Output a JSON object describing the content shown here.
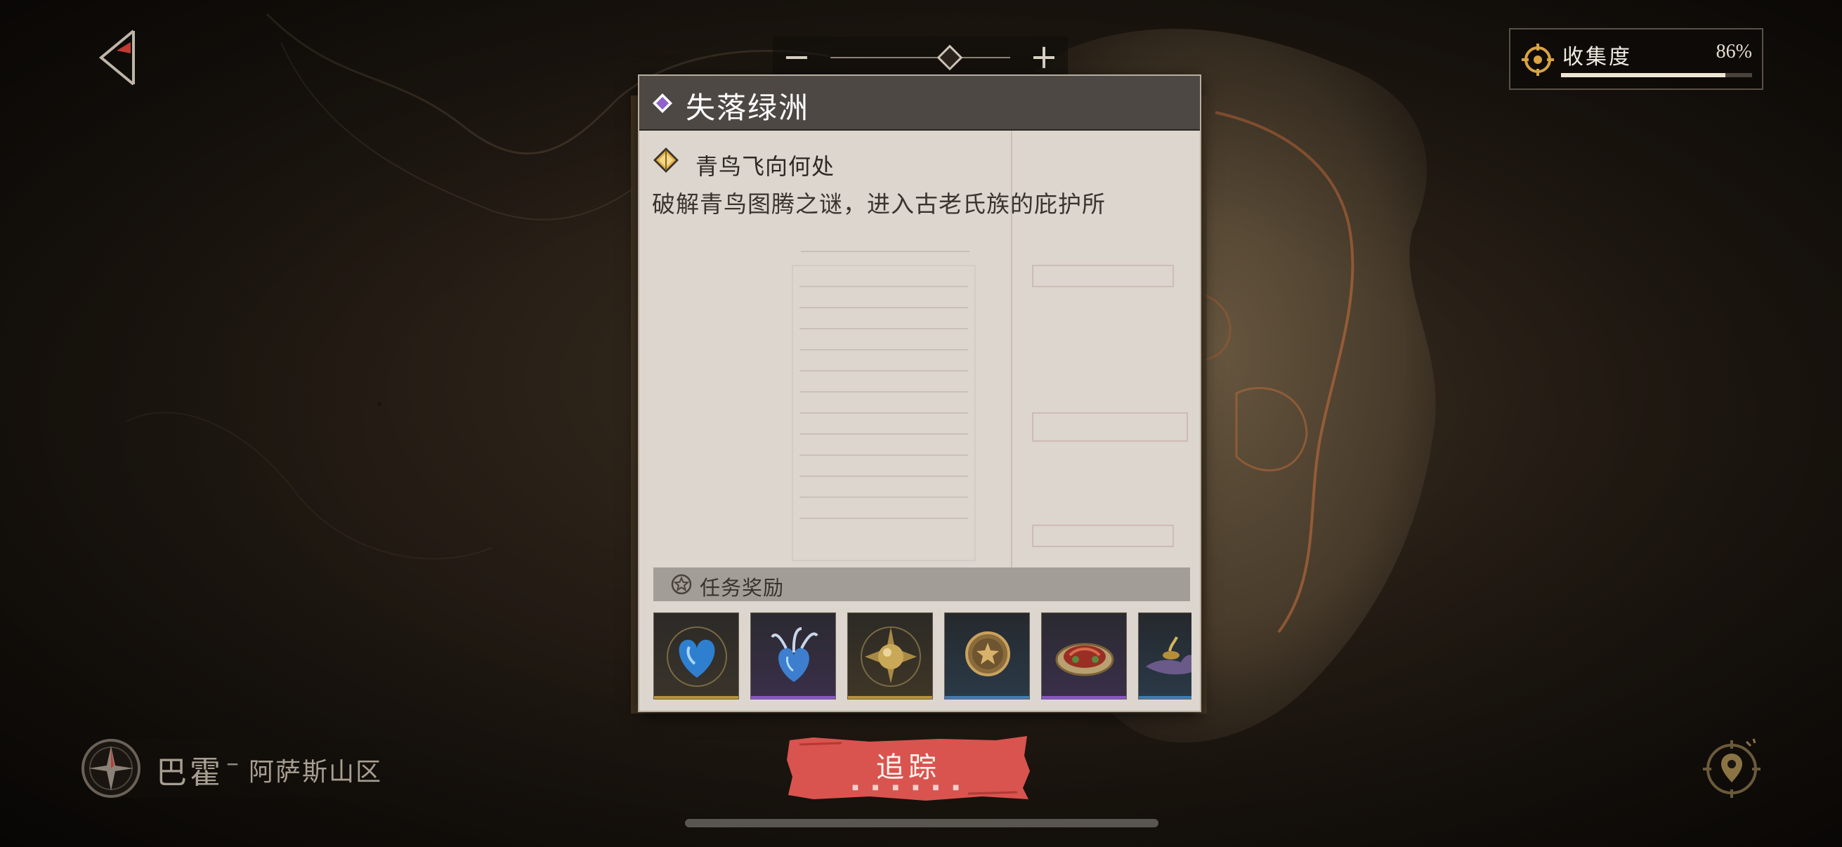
{
  "zoom": {
    "minus_label": "−",
    "plus_label": "+",
    "level": 0.5
  },
  "collection": {
    "label": "收集度",
    "value": "86%",
    "progress": 0.86
  },
  "quest": {
    "title": "失落绿洲",
    "subquest": "青鸟飞向何处",
    "description": "破解青鸟图腾之谜，进入古老氏族的庇护所",
    "rewards_label": "任务奖励",
    "rewards": [
      {
        "icon": "blue-heart-gem-icon",
        "rarity_color": "#b7943a"
      },
      {
        "icon": "tentacle-heart-gem-icon",
        "rarity_color": "#8a55c7"
      },
      {
        "icon": "golden-spiked-orb-icon",
        "rarity_color": "#b7943a"
      },
      {
        "icon": "bronze-star-coin-icon",
        "rarity_color": "#3d7eb3"
      },
      {
        "icon": "meat-platter-icon",
        "rarity_color": "#8a55c7"
      },
      {
        "icon": "oil-lamp-icon",
        "rarity_color": "#3d7eb3"
      }
    ]
  },
  "track_button": {
    "label": "追踪",
    "accent": "#d9534f"
  },
  "location": {
    "region": "巴霍",
    "separator": "–",
    "area": "阿萨斯山区"
  }
}
